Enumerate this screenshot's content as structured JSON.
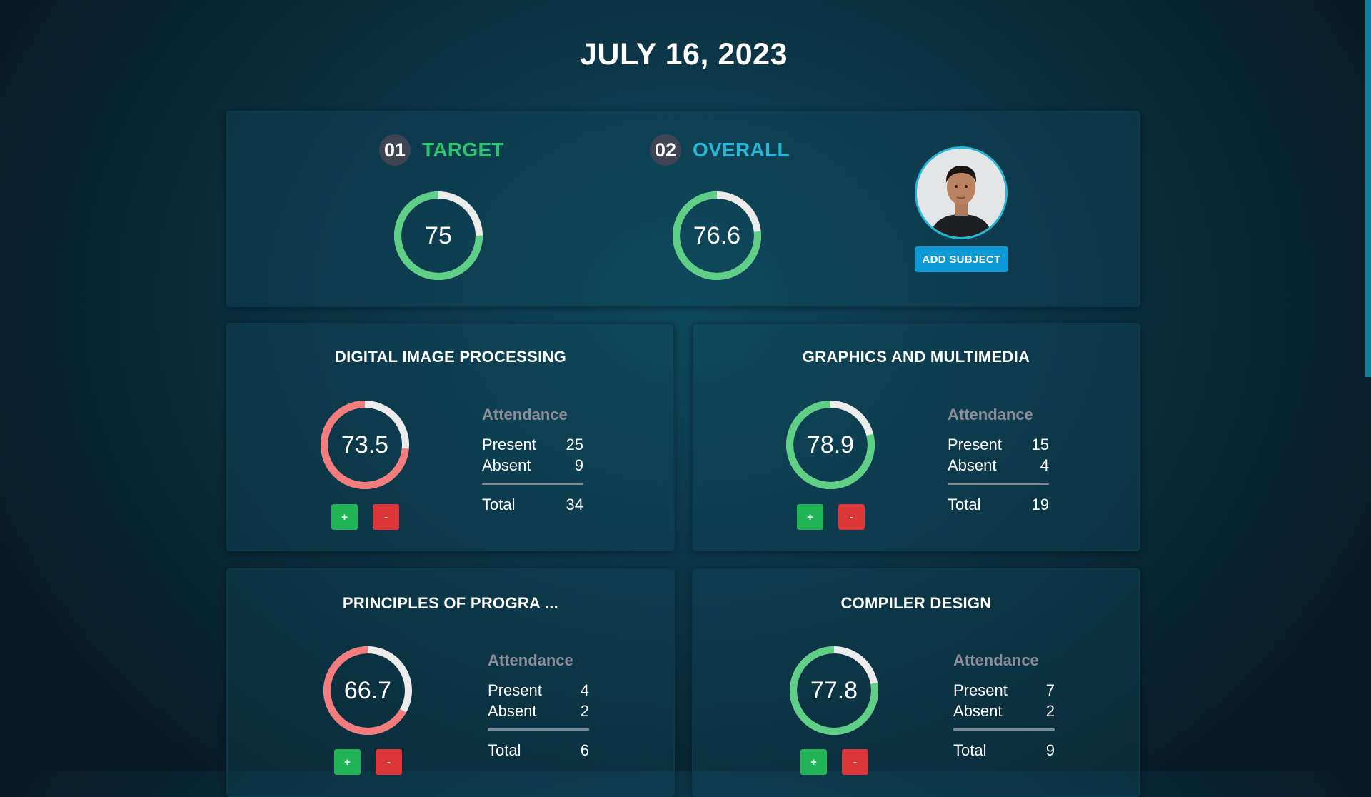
{
  "header": {
    "date": "JULY 16, 2023"
  },
  "summary": {
    "target": {
      "number": "01",
      "label": "TARGET",
      "value": "75",
      "percent": 75,
      "label_color": "#2dc56e"
    },
    "overall": {
      "number": "02",
      "label": "OVERALL",
      "value": "76.6",
      "percent": 76.6,
      "label_color": "#22b8d6"
    },
    "add_subject_label": "ADD SUBJECT"
  },
  "attendance_heading": "Attendance",
  "row_labels": {
    "present": "Present",
    "absent": "Absent",
    "total": "Total"
  },
  "buttons": {
    "plus": "+",
    "minus": "-"
  },
  "colors": {
    "good": "#5ecf85",
    "bad": "#f47c7c",
    "track": "#ececec"
  },
  "subjects": [
    {
      "title": "DIGITAL IMAGE PROCESSING",
      "percent": 73.5,
      "value": "73.5",
      "present": "25",
      "absent": "9",
      "total": "34",
      "status": "bad"
    },
    {
      "title": "GRAPHICS AND MULTIMEDIA",
      "percent": 78.9,
      "value": "78.9",
      "present": "15",
      "absent": "4",
      "total": "19",
      "status": "good"
    },
    {
      "title": "PRINCIPLES OF PROGRA ...",
      "percent": 66.7,
      "value": "66.7",
      "present": "4",
      "absent": "2",
      "total": "6",
      "status": "bad"
    },
    {
      "title": "COMPILER DESIGN",
      "percent": 77.8,
      "value": "77.8",
      "present": "7",
      "absent": "2",
      "total": "9",
      "status": "good"
    }
  ]
}
